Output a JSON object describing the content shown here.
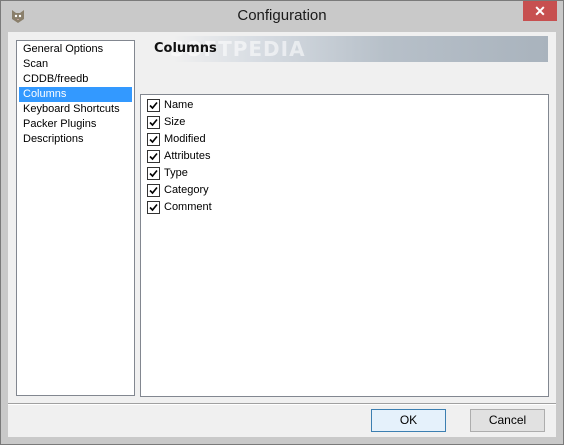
{
  "window": {
    "title": "Configuration",
    "close_glyph": "✕"
  },
  "sidebar": {
    "items": [
      {
        "label": "General Options"
      },
      {
        "label": "Scan"
      },
      {
        "label": "CDDB/freedb"
      },
      {
        "label": "Columns",
        "selected": true
      },
      {
        "label": "Keyboard Shortcuts"
      },
      {
        "label": "Packer Plugins"
      },
      {
        "label": "Descriptions"
      }
    ]
  },
  "panel": {
    "header": "Columns",
    "watermark": "SOFTPEDIA",
    "columns": [
      {
        "label": "Name",
        "checked": true
      },
      {
        "label": "Size",
        "checked": true
      },
      {
        "label": "Modified",
        "checked": true
      },
      {
        "label": "Attributes",
        "checked": true
      },
      {
        "label": "Type",
        "checked": true
      },
      {
        "label": "Category",
        "checked": true
      },
      {
        "label": "Comment",
        "checked": true
      }
    ]
  },
  "buttons": {
    "ok_label": "OK",
    "cancel_label": "Cancel"
  },
  "colors": {
    "selection": "#3399ff",
    "close_button": "#c75050"
  },
  "icons": {
    "app": "cat-icon",
    "close": "close-icon",
    "check": "checkmark-icon"
  }
}
